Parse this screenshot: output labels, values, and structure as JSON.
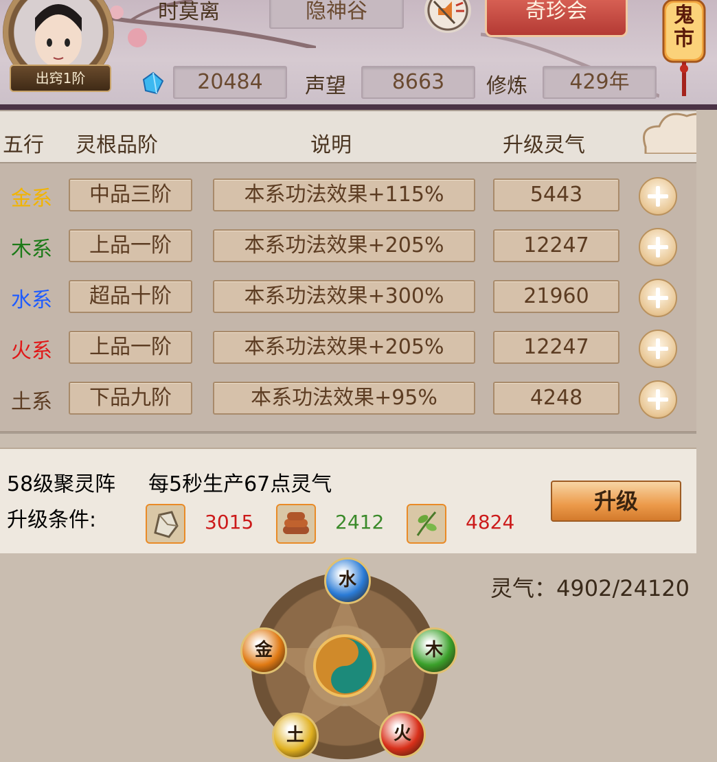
{
  "header": {
    "player_name": "时莫离",
    "rank_badge": "出窍1阶",
    "guild": "隐神谷",
    "treasure_button": "奇珍会",
    "ghost_market": "鬼市",
    "currency_value": "20484",
    "fame_label": "声望",
    "fame_value": "8663",
    "cultivation_label": "修炼",
    "cultivation_value": "429年"
  },
  "table": {
    "headers": [
      "五行",
      "灵根品阶",
      "说明",
      "升级灵气"
    ],
    "rows": [
      {
        "element": "金系",
        "color": "#f2b400",
        "grade": "中品三阶",
        "effect": "本系功法效果+115%",
        "qi": "5443"
      },
      {
        "element": "木系",
        "color": "#1c7a18",
        "grade": "上品一阶",
        "effect": "本系功法效果+205%",
        "qi": "12247"
      },
      {
        "element": "水系",
        "color": "#1f5cff",
        "grade": "超品十阶",
        "effect": "本系功法效果+300%",
        "qi": "21960"
      },
      {
        "element": "火系",
        "color": "#e01818",
        "grade": "上品一阶",
        "effect": "本系功法效果+205%",
        "qi": "12247"
      },
      {
        "element": "土系",
        "color": "#5c3c22",
        "grade": "下品九阶",
        "effect": "本系功法效果+95%",
        "qi": "4248"
      }
    ]
  },
  "array": {
    "title": "58级聚灵阵",
    "description": "每5秒生产67点灵气",
    "condition_label": "升级条件:",
    "materials": [
      {
        "icon": "ore-icon",
        "value": "3015",
        "color": "#cc1a1a"
      },
      {
        "icon": "wood-logs-icon",
        "value": "2412",
        "color": "#3a8a2a"
      },
      {
        "icon": "herb-icon",
        "value": "4824",
        "color": "#cc1a1a"
      }
    ],
    "upgrade_button": "升级"
  },
  "qi_readout": "灵气：4902/24120",
  "wheel": {
    "orbs": [
      {
        "char": "水",
        "color": "#2a7bd6"
      },
      {
        "char": "木",
        "color": "#3aa02a"
      },
      {
        "char": "金",
        "color": "#e07a14"
      },
      {
        "char": "土",
        "color": "#e0b020"
      },
      {
        "char": "火",
        "color": "#d8301a"
      }
    ]
  }
}
